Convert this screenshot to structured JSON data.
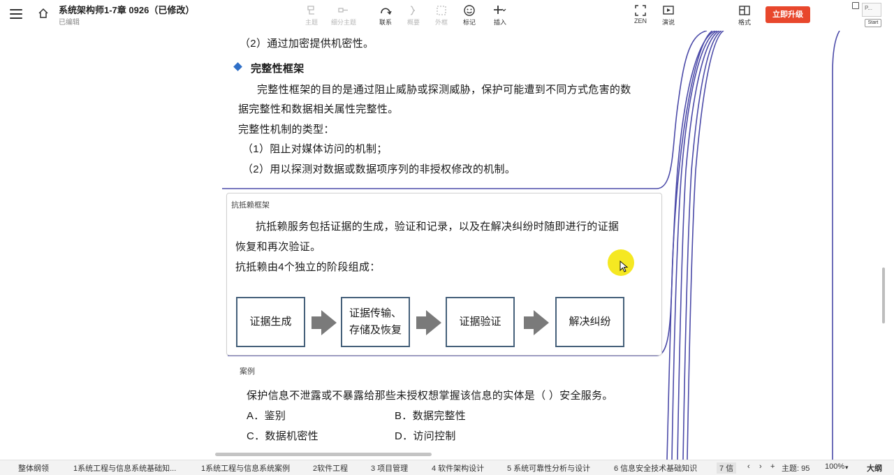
{
  "app": {
    "title": "系统架构师1-7章 0926（已修改）",
    "status": "已编辑",
    "upgrade_label": "立即升级",
    "preview_label": "P...",
    "start_label": "Start"
  },
  "toolbar": {
    "tools": [
      {
        "label": "主题",
        "icon": "topic-icon",
        "enabled": false
      },
      {
        "label": "细分主题",
        "icon": "subtopic-icon",
        "enabled": false
      },
      {
        "label": "联系",
        "icon": "relationship-icon",
        "enabled": true
      },
      {
        "label": "概要",
        "icon": "summary-icon",
        "enabled": false
      },
      {
        "label": "外框",
        "icon": "boundary-icon",
        "enabled": false
      },
      {
        "label": "标记",
        "icon": "marker-icon",
        "enabled": true
      },
      {
        "label": "插入",
        "icon": "insert-icon",
        "enabled": true
      },
      {
        "label": "ZEN",
        "icon": "zen-icon",
        "enabled": true
      },
      {
        "label": "演说",
        "icon": "pitch-icon",
        "enabled": true
      },
      {
        "label": "格式",
        "icon": "format-icon",
        "enabled": true
      }
    ]
  },
  "content": {
    "line1": "（2）通过加密提供机密性。",
    "heading": "完整性框架",
    "para1a": "完整性框架的目的是通过阻止威胁或探测威胁，保护可能遭到不同方式危害的数",
    "para1b": "据完整性和数据相关属性完整性。",
    "types_label": "完整性机制的类型：",
    "type1": "（1）阻止对媒体访问的机制；",
    "type2": "（2）用以探测对数据或数据项序列的非授权修改的机制。"
  },
  "node": {
    "label": "抗抵赖框架",
    "para_a": "抗抵赖服务包括证据的生成，验证和记录，以及在解决纠纷时随即进行的证据",
    "para_b": "恢复和再次验证。",
    "stages_intro": "抗抵赖由4个独立的阶段组成：",
    "stages": [
      {
        "line1": "证据生成",
        "line2": ""
      },
      {
        "line1": "证据传输、",
        "line2": "存储及恢复"
      },
      {
        "line1": "证据验证",
        "line2": ""
      },
      {
        "line1": "解决纠纷",
        "line2": ""
      }
    ]
  },
  "case": {
    "label": "案例",
    "question": "保护信息不泄露或不暴露给那些未授权想掌握该信息的实体是（    ）安全服务。",
    "options": {
      "a": "A．鉴别",
      "b": "B．数据完整性",
      "c": "C．数据机密性",
      "d": "D．访问控制"
    }
  },
  "bottom": {
    "tabs": [
      "整体纲领",
      "1系统工程与信息系统基础知...",
      "1系统工程与信息系统案例",
      "2软件工程",
      "3 项目管理",
      "4 软件架构设计",
      "5 系统可靠性分析与设计",
      "6 信息安全技术基础知识",
      "7 信"
    ],
    "topic_count": "主题: 95",
    "zoom": "100%",
    "outline_label": "大纲"
  },
  "colors": {
    "accent": "#e8472c",
    "bullet": "#2f6fc7",
    "branch_line": "#4b4aa8",
    "stage_border": "#45607a",
    "arrow": "#7a7a7a",
    "cursor_highlight": "#f4e60a"
  }
}
